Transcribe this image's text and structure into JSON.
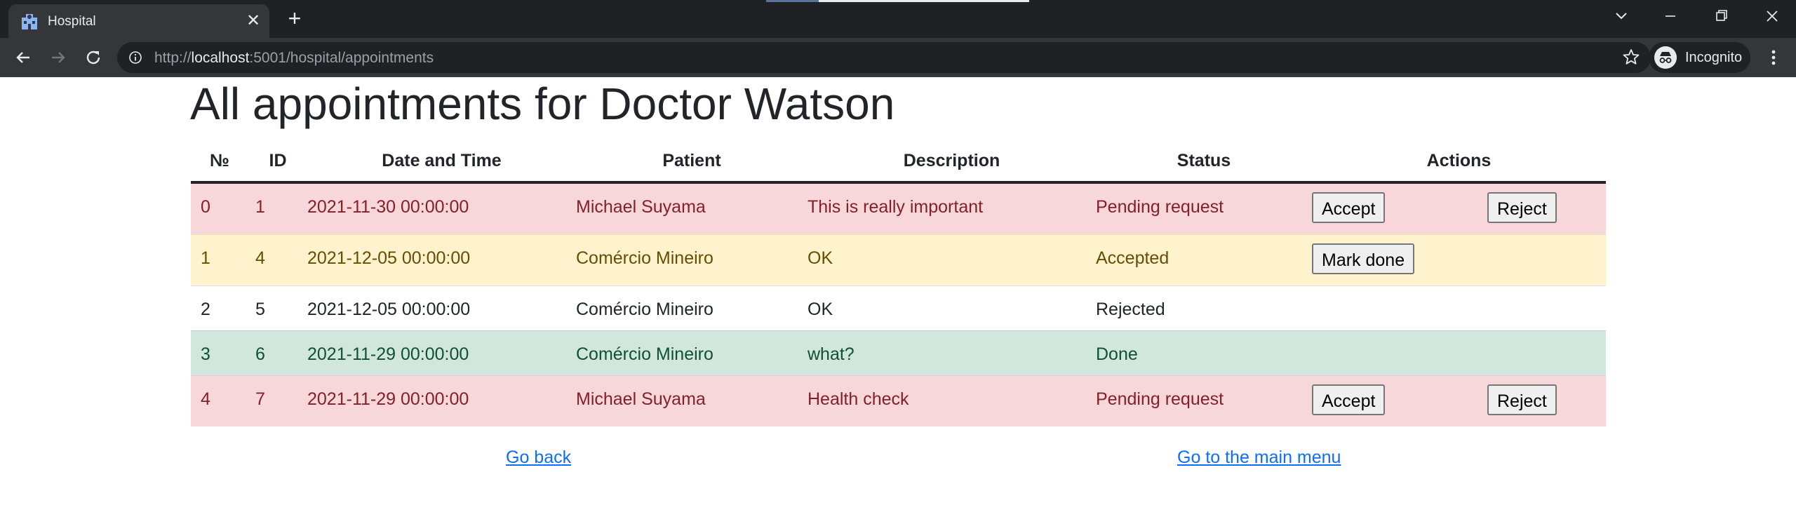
{
  "browser": {
    "tab_title": "Hospital",
    "url_scheme": "http://",
    "url_host": "localhost",
    "url_rest": ":5001/hospital/appointments",
    "profile_label": "Incognito"
  },
  "page": {
    "title": "All appointments for Doctor Watson"
  },
  "table": {
    "headers": [
      "№",
      "ID",
      "Date and Time",
      "Patient",
      "Description",
      "Status",
      "Actions"
    ],
    "rows": [
      {
        "n": "0",
        "id": "1",
        "datetime": "2021-11-30 00:00:00",
        "patient": "Michael Suyama",
        "description": "This is really important",
        "status": "Pending request",
        "actions": [
          "Accept",
          "Reject"
        ]
      },
      {
        "n": "1",
        "id": "4",
        "datetime": "2021-12-05 00:00:00",
        "patient": "Comércio Mineiro",
        "description": "OK",
        "status": "Accepted",
        "actions": [
          "Mark done"
        ]
      },
      {
        "n": "2",
        "id": "5",
        "datetime": "2021-12-05 00:00:00",
        "patient": "Comércio Mineiro",
        "description": "OK",
        "status": "Rejected",
        "actions": []
      },
      {
        "n": "3",
        "id": "6",
        "datetime": "2021-11-29 00:00:00",
        "patient": "Comércio Mineiro",
        "description": "what?",
        "status": "Done",
        "actions": []
      },
      {
        "n": "4",
        "id": "7",
        "datetime": "2021-11-29 00:00:00",
        "patient": "Michael Suyama",
        "description": "Health check",
        "status": "Pending request",
        "actions": [
          "Accept",
          "Reject"
        ]
      }
    ]
  },
  "links": {
    "back": "Go back",
    "main_menu": "Go to the main menu"
  },
  "colors": {
    "pending": "#f8d7da",
    "accepted": "#fff3cd",
    "done": "#d1e7dd",
    "link": "#0d6efd"
  }
}
